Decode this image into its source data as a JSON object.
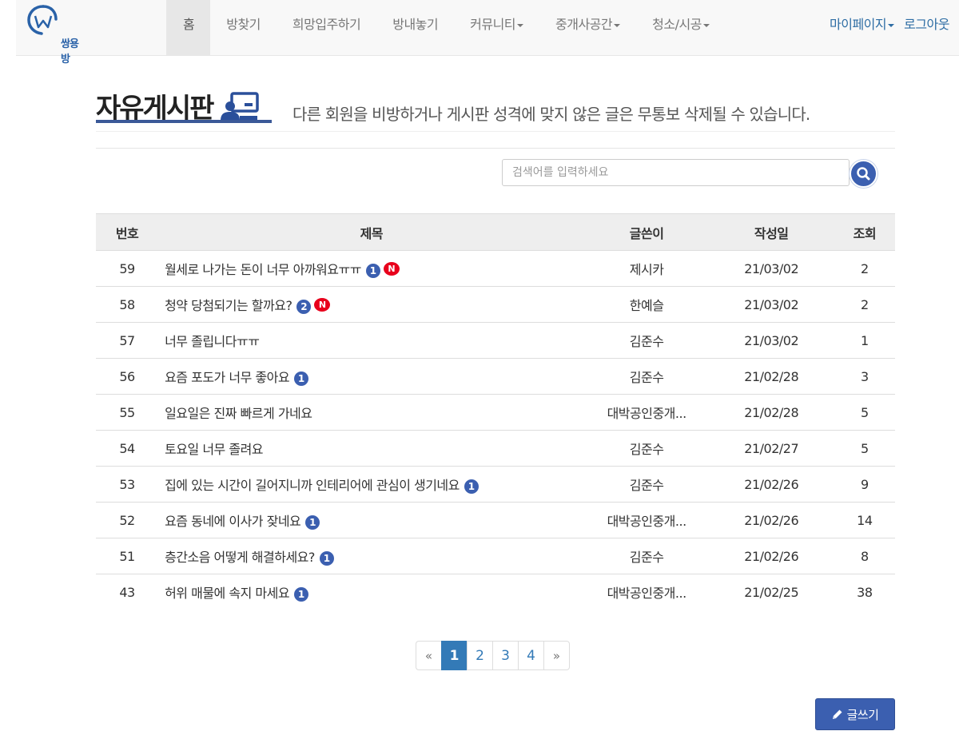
{
  "app": {
    "logo_text": "쌍용방"
  },
  "nav": {
    "items": [
      {
        "label": "홈",
        "active": true,
        "dropdown": false
      },
      {
        "label": "방찾기",
        "active": false,
        "dropdown": false
      },
      {
        "label": "희망입주하기",
        "active": false,
        "dropdown": false
      },
      {
        "label": "방내놓기",
        "active": false,
        "dropdown": false
      },
      {
        "label": "커뮤니티",
        "active": false,
        "dropdown": true
      },
      {
        "label": "중개사공간",
        "active": false,
        "dropdown": true
      },
      {
        "label": "청소/시공",
        "active": false,
        "dropdown": true
      }
    ],
    "right": {
      "mypage": "마이페이지",
      "logout": "로그아웃"
    }
  },
  "board": {
    "title": "자유게시판",
    "description": "다른 회원을 비방하거나 게시판 성격에 맞지 않은 글은 무통보 삭제될 수 있습니다.",
    "search_placeholder": "검색어를 입력하세요",
    "columns": {
      "num": "번호",
      "title": "제목",
      "author": "글쓴이",
      "date": "작성일",
      "views": "조회"
    },
    "posts": [
      {
        "num": "59",
        "title": "월세로 나가는 돈이 너무 아까워요ㅠㅠ",
        "comments": "1",
        "is_new": true,
        "author": "제시카",
        "date": "21/03/02",
        "views": "2"
      },
      {
        "num": "58",
        "title": "청약 당첨되기는 할까요?",
        "comments": "2",
        "is_new": true,
        "author": "한예슬",
        "date": "21/03/02",
        "views": "2"
      },
      {
        "num": "57",
        "title": "너무 졸립니다ㅠㅠ",
        "comments": "",
        "is_new": false,
        "author": "김준수",
        "date": "21/03/02",
        "views": "1"
      },
      {
        "num": "56",
        "title": "요즘 포도가 너무 좋아요",
        "comments": "1",
        "is_new": false,
        "author": "김준수",
        "date": "21/02/28",
        "views": "3"
      },
      {
        "num": "55",
        "title": "일요일은 진짜 빠르게 가네요",
        "comments": "",
        "is_new": false,
        "author": "대박공인중개...",
        "date": "21/02/28",
        "views": "5"
      },
      {
        "num": "54",
        "title": "토요일 너무 졸려요",
        "comments": "",
        "is_new": false,
        "author": "김준수",
        "date": "21/02/27",
        "views": "5"
      },
      {
        "num": "53",
        "title": "집에 있는 시간이 길어지니까 인테리어에 관심이 생기네요",
        "comments": "1",
        "is_new": false,
        "author": "김준수",
        "date": "21/02/26",
        "views": "9"
      },
      {
        "num": "52",
        "title": "요즘 동네에 이사가 잦네요",
        "comments": "1",
        "is_new": false,
        "author": "대박공인중개...",
        "date": "21/02/26",
        "views": "14"
      },
      {
        "num": "51",
        "title": "층간소음 어떻게 해결하세요?",
        "comments": "1",
        "is_new": false,
        "author": "김준수",
        "date": "21/02/26",
        "views": "8"
      },
      {
        "num": "43",
        "title": "허위 매물에 속지 마세요",
        "comments": "1",
        "is_new": false,
        "author": "대박공인중개...",
        "date": "21/02/25",
        "views": "38"
      }
    ],
    "new_badge_label": "N",
    "pagination": {
      "prev": "«",
      "pages": [
        "1",
        "2",
        "3",
        "4"
      ],
      "current": "1",
      "next": "»"
    },
    "write_button": "글쓰기"
  },
  "colors": {
    "accent": "#3b5fb0",
    "link": "#337ab7",
    "new_badge": "#e8001c"
  }
}
